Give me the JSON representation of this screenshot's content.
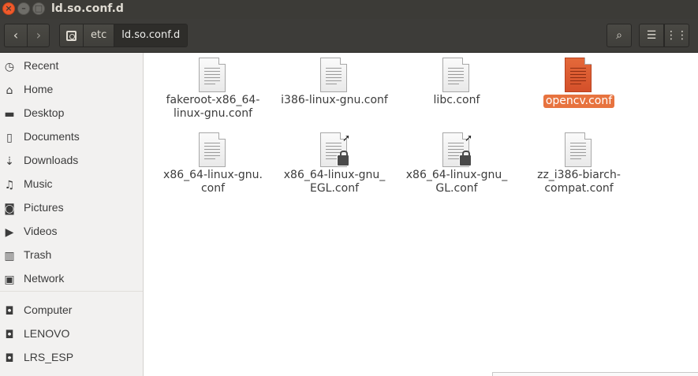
{
  "window": {
    "title": "ld.so.conf.d",
    "close_glyph": "×",
    "min_glyph": "–",
    "max_glyph": "□"
  },
  "toolbar": {
    "back_icon": "‹",
    "forward_icon": "›",
    "breadcrumbs": [
      "etc",
      "ld.so.conf.d"
    ],
    "search_icon": "⌕",
    "list_icon": "☰",
    "grid_icon": "⋮⋮"
  },
  "sidebar": {
    "places": [
      {
        "label": "Recent",
        "icon": "clock-icon",
        "glyph": "◷"
      },
      {
        "label": "Home",
        "icon": "home-icon",
        "glyph": "⌂"
      },
      {
        "label": "Desktop",
        "icon": "folder-icon",
        "glyph": "▬"
      },
      {
        "label": "Documents",
        "icon": "document-icon",
        "glyph": "▯"
      },
      {
        "label": "Downloads",
        "icon": "download-icon",
        "glyph": "⇣"
      },
      {
        "label": "Music",
        "icon": "music-icon",
        "glyph": "♫"
      },
      {
        "label": "Pictures",
        "icon": "camera-icon",
        "glyph": "◙"
      },
      {
        "label": "Videos",
        "icon": "video-icon",
        "glyph": "▶"
      },
      {
        "label": "Trash",
        "icon": "trash-icon",
        "glyph": "▥"
      },
      {
        "label": "Network",
        "icon": "network-icon",
        "glyph": "▣"
      }
    ],
    "devices": [
      {
        "label": "Computer",
        "icon": "drive-icon",
        "glyph": "◘"
      },
      {
        "label": "LENOVO",
        "icon": "drive-icon",
        "glyph": "◘"
      },
      {
        "label": "LRS_ESP",
        "icon": "drive-icon",
        "glyph": "◘"
      }
    ]
  },
  "files": [
    {
      "name_line1": "fakeroot-x86_64-",
      "name_line2": "linux-gnu.conf",
      "selected": false,
      "symlink": false
    },
    {
      "name_line1": "i386-linux-gnu.conf",
      "name_line2": "",
      "selected": false,
      "symlink": false
    },
    {
      "name_line1": "libc.conf",
      "name_line2": "",
      "selected": false,
      "symlink": false
    },
    {
      "name_line1": "opencv.conf",
      "name_line2": "",
      "selected": true,
      "symlink": false
    },
    {
      "name_line1": "x86_64-linux-gnu.",
      "name_line2": "conf",
      "selected": false,
      "symlink": false
    },
    {
      "name_line1": "x86_64-linux-gnu_",
      "name_line2": "EGL.conf",
      "selected": false,
      "symlink": true
    },
    {
      "name_line1": "x86_64-linux-gnu_",
      "name_line2": "GL.conf",
      "selected": false,
      "symlink": true
    },
    {
      "name_line1": "zz_i386-biarch-",
      "name_line2": "compat.conf",
      "selected": false,
      "symlink": false
    }
  ],
  "colors": {
    "accent": "#e7733f",
    "titlebar": "#3c3b37",
    "sidebar": "#f2f1f0"
  }
}
